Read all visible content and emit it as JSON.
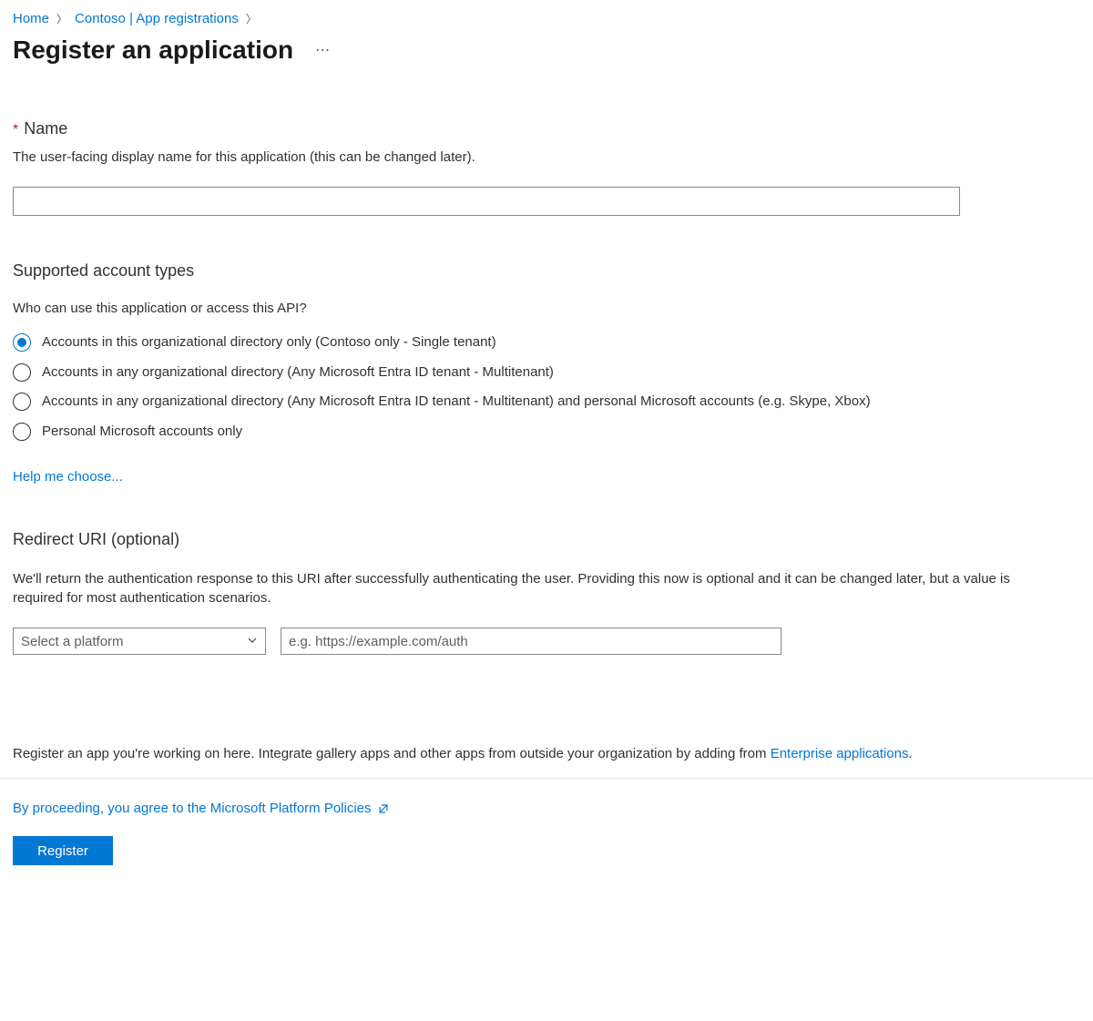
{
  "breadcrumb": {
    "home": "Home",
    "tenant": "Contoso | App registrations"
  },
  "page": {
    "title": "Register an application"
  },
  "name_section": {
    "label": "Name",
    "desc": "The user-facing display name for this application (this can be changed later).",
    "value": ""
  },
  "account_types": {
    "heading": "Supported account types",
    "sub": "Who can use this application or access this API?",
    "options": [
      "Accounts in this organizational directory only (Contoso only - Single tenant)",
      "Accounts in any organizational directory (Any Microsoft Entra ID tenant - Multitenant)",
      "Accounts in any organizational directory (Any Microsoft Entra ID tenant - Multitenant) and personal Microsoft accounts (e.g. Skype, Xbox)",
      "Personal Microsoft accounts only"
    ],
    "selected_index": 0,
    "help_link": "Help me choose..."
  },
  "redirect": {
    "heading": "Redirect URI (optional)",
    "desc": "We'll return the authentication response to this URI after successfully authenticating the user. Providing this now is optional and it can be changed later, but a value is required for most authentication scenarios.",
    "platform_placeholder": "Select a platform",
    "uri_placeholder": "e.g. https://example.com/auth"
  },
  "footer": {
    "hint_prefix": "Register an app you're working on here. Integrate gallery apps and other apps from outside your organization by adding from ",
    "hint_link": "Enterprise applications",
    "hint_suffix": ".",
    "policy_text": "By proceeding, you agree to the Microsoft Platform Policies",
    "register_button": "Register"
  }
}
